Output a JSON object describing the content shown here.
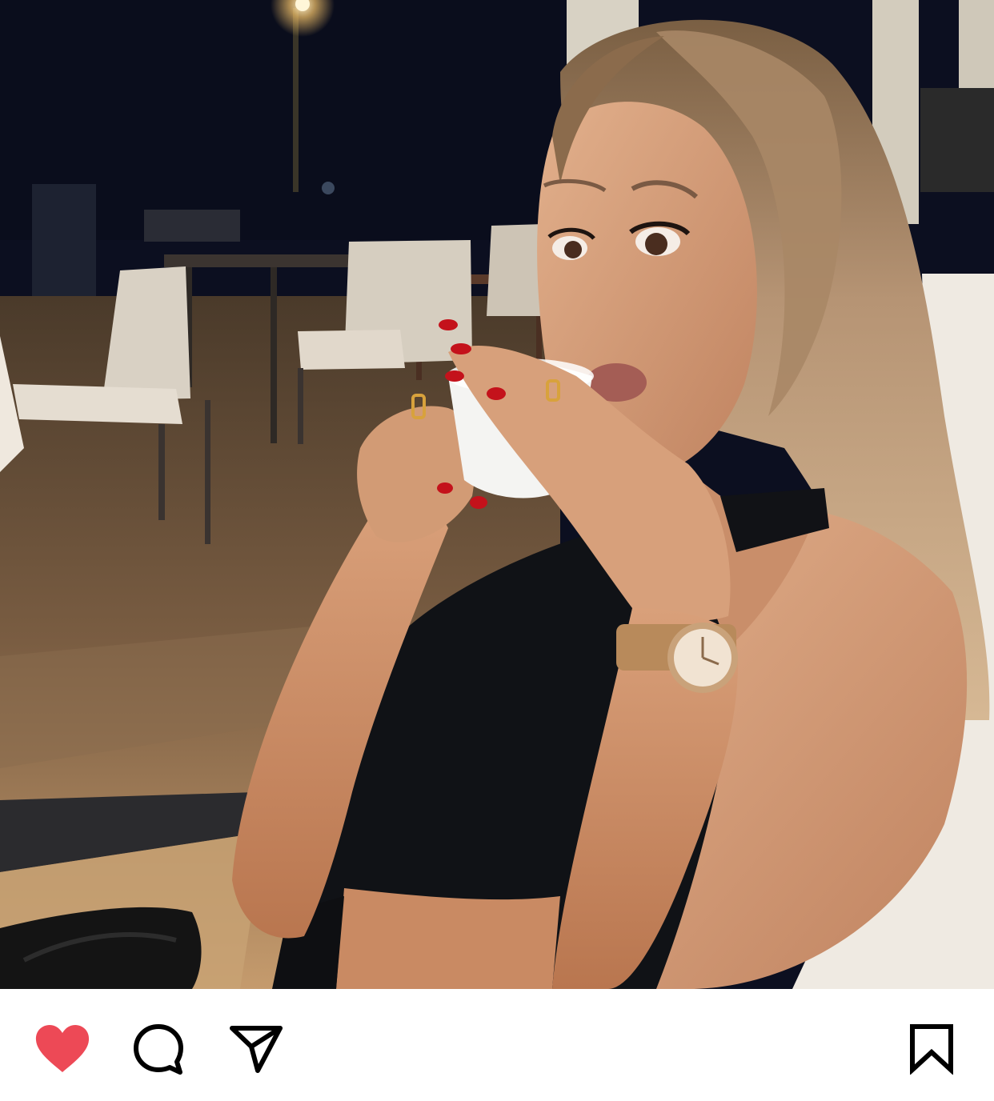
{
  "post": {
    "photo": {
      "alt": ""
    },
    "actions": {
      "like": {
        "icon": "heart-icon",
        "state": "liked",
        "color": "#ed4956"
      },
      "comment": {
        "icon": "comment-bubble-icon"
      },
      "share": {
        "icon": "paper-plane-icon"
      },
      "save": {
        "icon": "bookmark-icon",
        "state": "not-saved"
      }
    }
  },
  "colors": {
    "icon": "#000000",
    "like_active": "#ed4956",
    "background": "#ffffff"
  }
}
